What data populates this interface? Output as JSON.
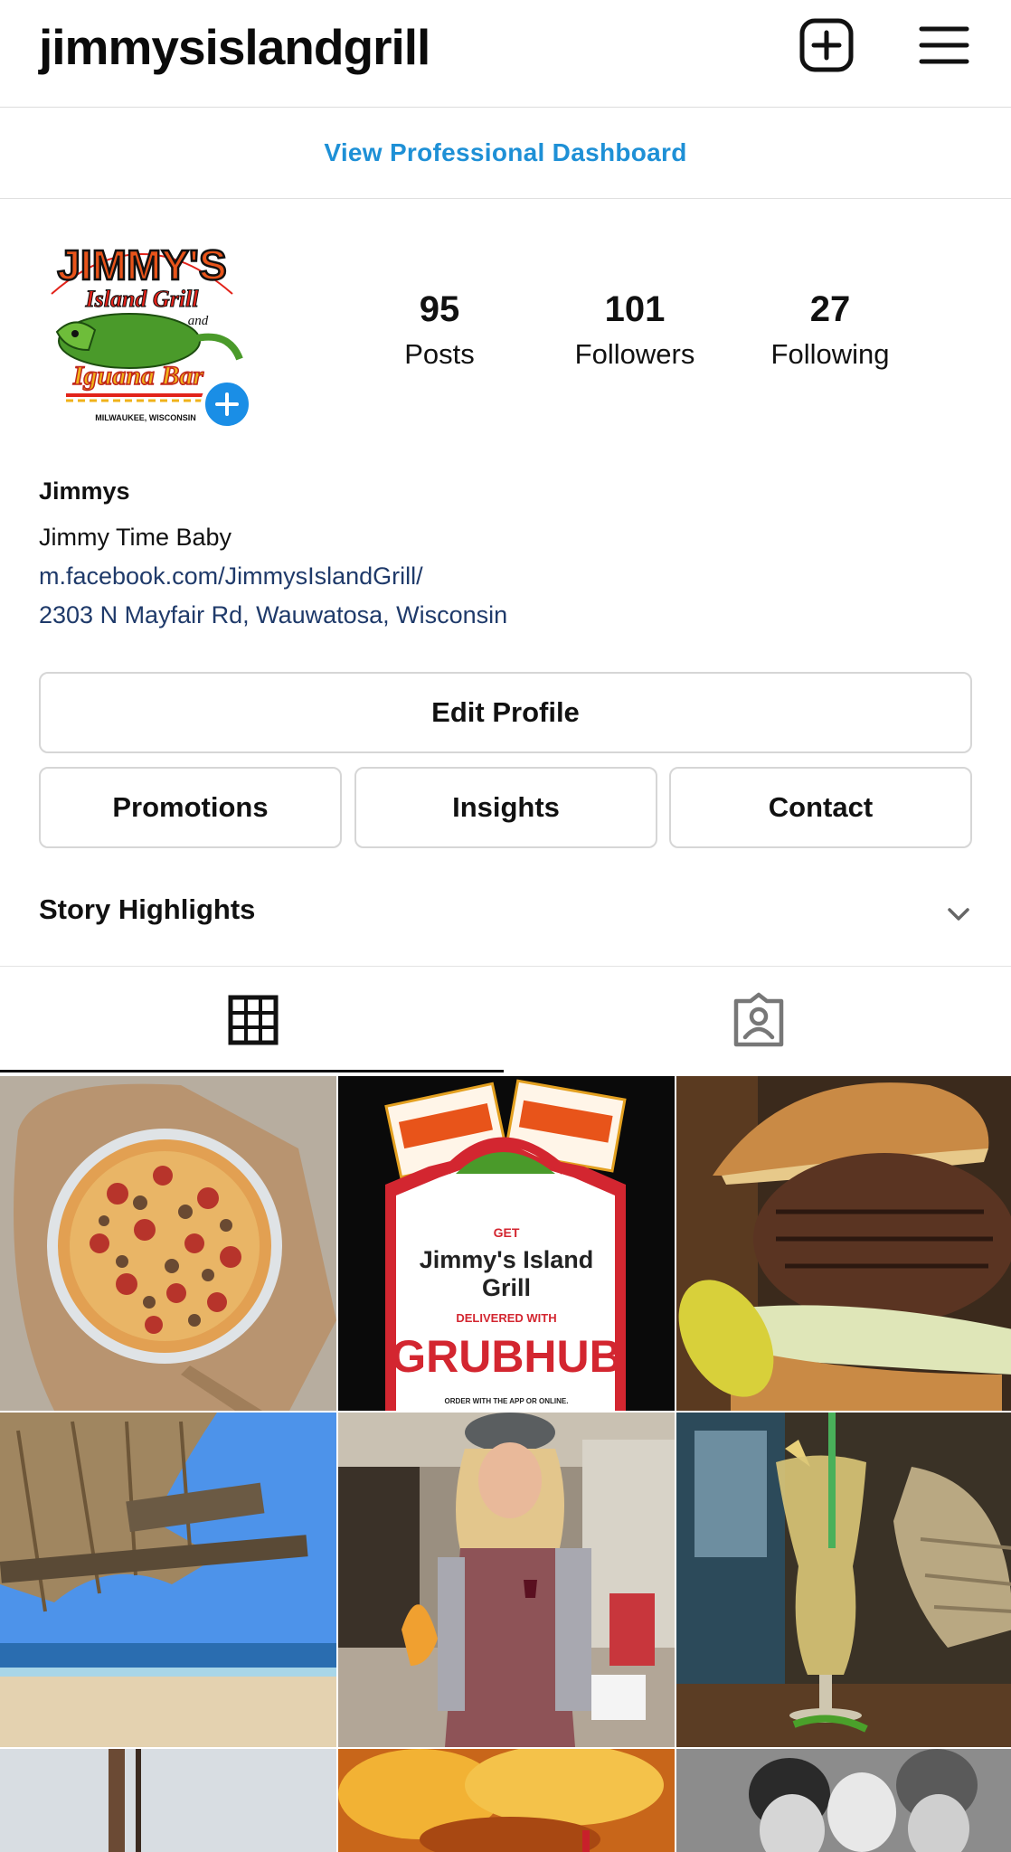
{
  "header": {
    "username": "jimmysislandgrill",
    "new_post_icon": "plus-square-icon",
    "menu_icon": "hamburger-menu-icon"
  },
  "dashboard": {
    "label": "View Professional Dashboard"
  },
  "profile": {
    "avatar_text": {
      "top": "JIMMY'S",
      "island_grill": "Island Grill",
      "and": "and",
      "iguana_bar": "Iguana Bar",
      "city": "MILWAUKEE, WISCONSIN"
    },
    "stats": [
      {
        "value": "95",
        "label": "Posts"
      },
      {
        "value": "101",
        "label": "Followers"
      },
      {
        "value": "27",
        "label": "Following"
      }
    ],
    "name": "Jimmys",
    "tagline": "Jimmy Time Baby",
    "link": "m.facebook.com/JimmysIslandGrill/",
    "address": "2303 N Mayfair Rd, Wauwatosa, Wisconsin"
  },
  "buttons": {
    "edit_profile": "Edit Profile",
    "promotions": "Promotions",
    "insights": "Insights",
    "contact": "Contact"
  },
  "highlights": {
    "label": "Story Highlights"
  },
  "tabs": [
    {
      "icon": "grid-icon",
      "active": true
    },
    {
      "icon": "tagged-user-icon",
      "active": false
    }
  ],
  "posts": {
    "grubhub": {
      "get": "GET",
      "title1": "Jimmy's Island",
      "title2": "Grill",
      "delivered": "DELIVERED WITH",
      "brand": "GRUBHUB",
      "order": "ORDER WITH THE APP OR ONLINE."
    }
  },
  "colors": {
    "accent_blue": "#1e90d6",
    "link_navy": "#1f3a6a",
    "grubhub_red": "#d32630",
    "plus_badge": "#1a8ee6"
  }
}
